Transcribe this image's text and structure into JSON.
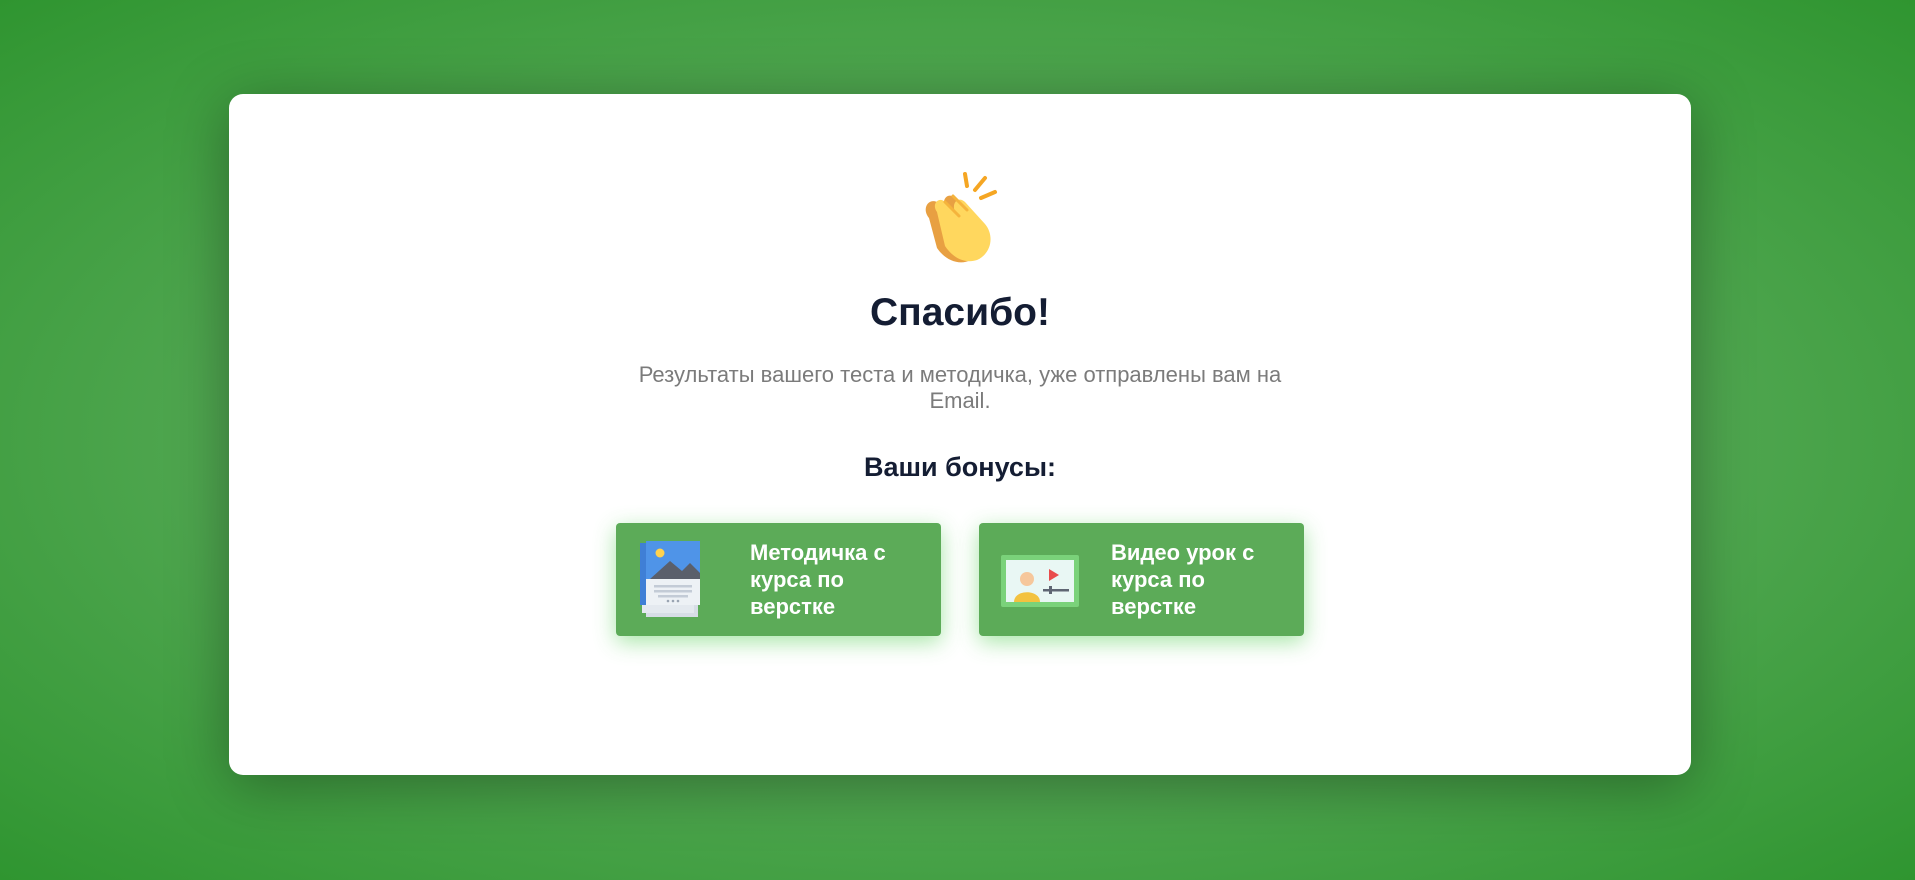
{
  "thanks": {
    "icon": "clapping-hands-icon",
    "title": "Спасибо!",
    "subtitle": "Результаты вашего теста и методичка, уже отправлены вам на Email."
  },
  "bonuses": {
    "heading": "Ваши бонусы:",
    "items": [
      {
        "label": "Методичка с курса по верстке",
        "icon": "document-image-icon"
      },
      {
        "label": "Видео урок с курса по верстке",
        "icon": "video-lesson-icon"
      }
    ]
  },
  "colors": {
    "background": "#5aac5a",
    "card": "#ffffff",
    "bonus_button": "#5cab58",
    "title": "#141d33",
    "subtitle": "#7b7b7b"
  }
}
